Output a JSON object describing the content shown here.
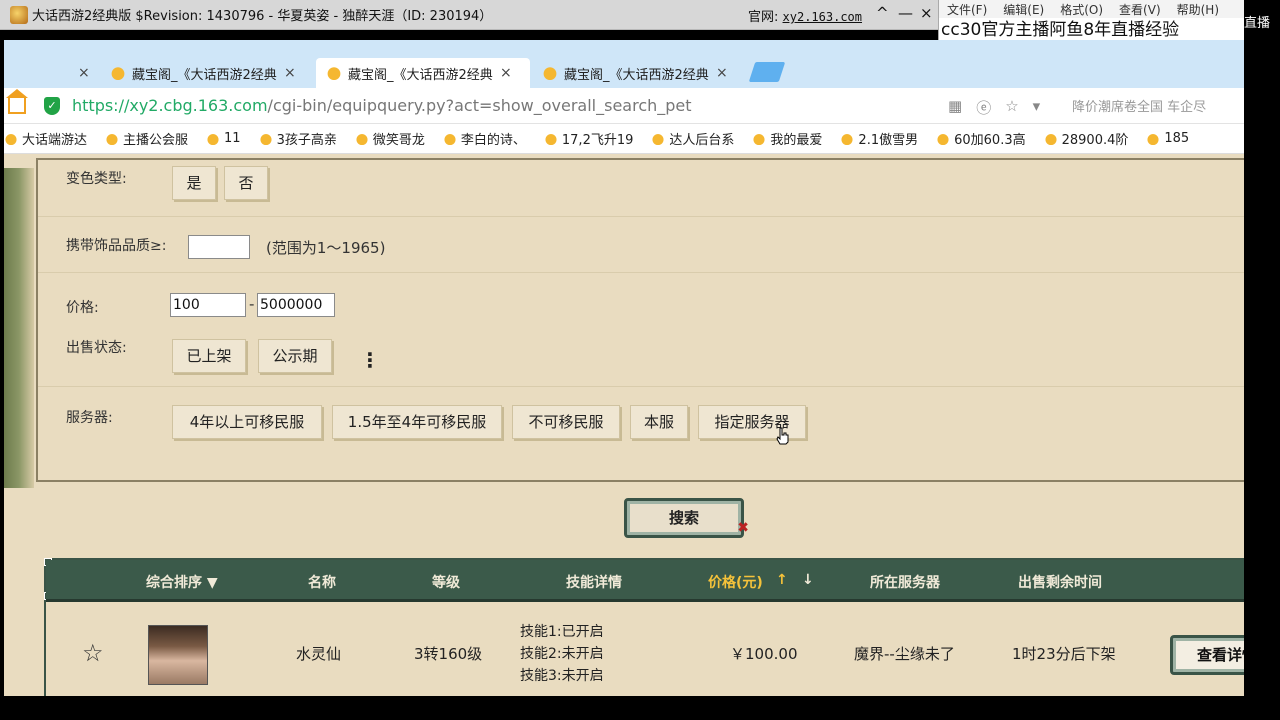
{
  "game_window": {
    "title": "大话西游2经典版 $Revision: 1430796 - 华夏英姿 - 独醉天涯（ID: 230194）",
    "site_label": "官网:",
    "site_url": "xy2.163.com",
    "controls": [
      "^",
      "—",
      "×"
    ]
  },
  "notepad": {
    "menu": [
      "文件(F)",
      "编辑(E)",
      "格式(O)",
      "查看(V)",
      "帮助(H)"
    ],
    "text": "cc30官方主播阿鱼8年直播经验"
  },
  "right_strip_text": "直播",
  "browser": {
    "tabs": [
      {
        "label": "",
        "active": false
      },
      {
        "label": "藏宝阁_《大话西游2经典",
        "active": false
      },
      {
        "label": "藏宝阁_《大话西游2经典",
        "active": true
      },
      {
        "label": "藏宝阁_《大话西游2经典",
        "active": false
      }
    ],
    "url_host": "https://xy2.cbg.163.com",
    "url_path": "/cgi-bin/equipquery.py?act=show_overall_search_pet",
    "search_suggestion": "降价潮席卷全国 车企尽",
    "bookmarks": [
      "大话端游达",
      "主播公会服",
      "11",
      "3孩子高亲",
      "微笑哥龙",
      "李白的诗、",
      "17,2飞升19",
      "达人后台系",
      "我的最爱",
      "2.1傲雪男",
      "60加60.3高",
      "28900.4阶",
      "185"
    ]
  },
  "filters": {
    "color_change": {
      "label": "变色类型:",
      "options": [
        "是",
        "否"
      ]
    },
    "accessory_quality": {
      "label": "携带饰品品质≥:",
      "value": "",
      "hint": "(范围为1～1965)"
    },
    "price": {
      "label": "价格:",
      "min": "100",
      "dash": "-",
      "max": "5000000"
    },
    "sale_status": {
      "label": "出售状态:",
      "options": [
        "已上架",
        "公示期"
      ],
      "more": "⋮"
    },
    "server": {
      "label": "服务器:",
      "options": [
        "4年以上可移民服",
        "1.5年至4年可移民服",
        "不可移民服",
        "本服",
        "指定服务器"
      ]
    }
  },
  "search_button": "搜索",
  "table": {
    "headers": {
      "sort": "综合排序 ▼",
      "name": "名称",
      "level": "等级",
      "skills": "技能详情",
      "price": "价格(元)",
      "price_up": "↑",
      "price_down": "↓",
      "server": "所在服务器",
      "time_left": "出售剩余时间"
    },
    "rows": [
      {
        "name": "水灵仙",
        "level": "3转160级",
        "skills": [
          "技能1:已开启",
          "技能2:未开启",
          "技能3:未开启"
        ],
        "price": "￥100.00",
        "server": "魔界--尘缘未了",
        "time_left": "1时23分后下架",
        "action": "查看详情"
      }
    ]
  }
}
